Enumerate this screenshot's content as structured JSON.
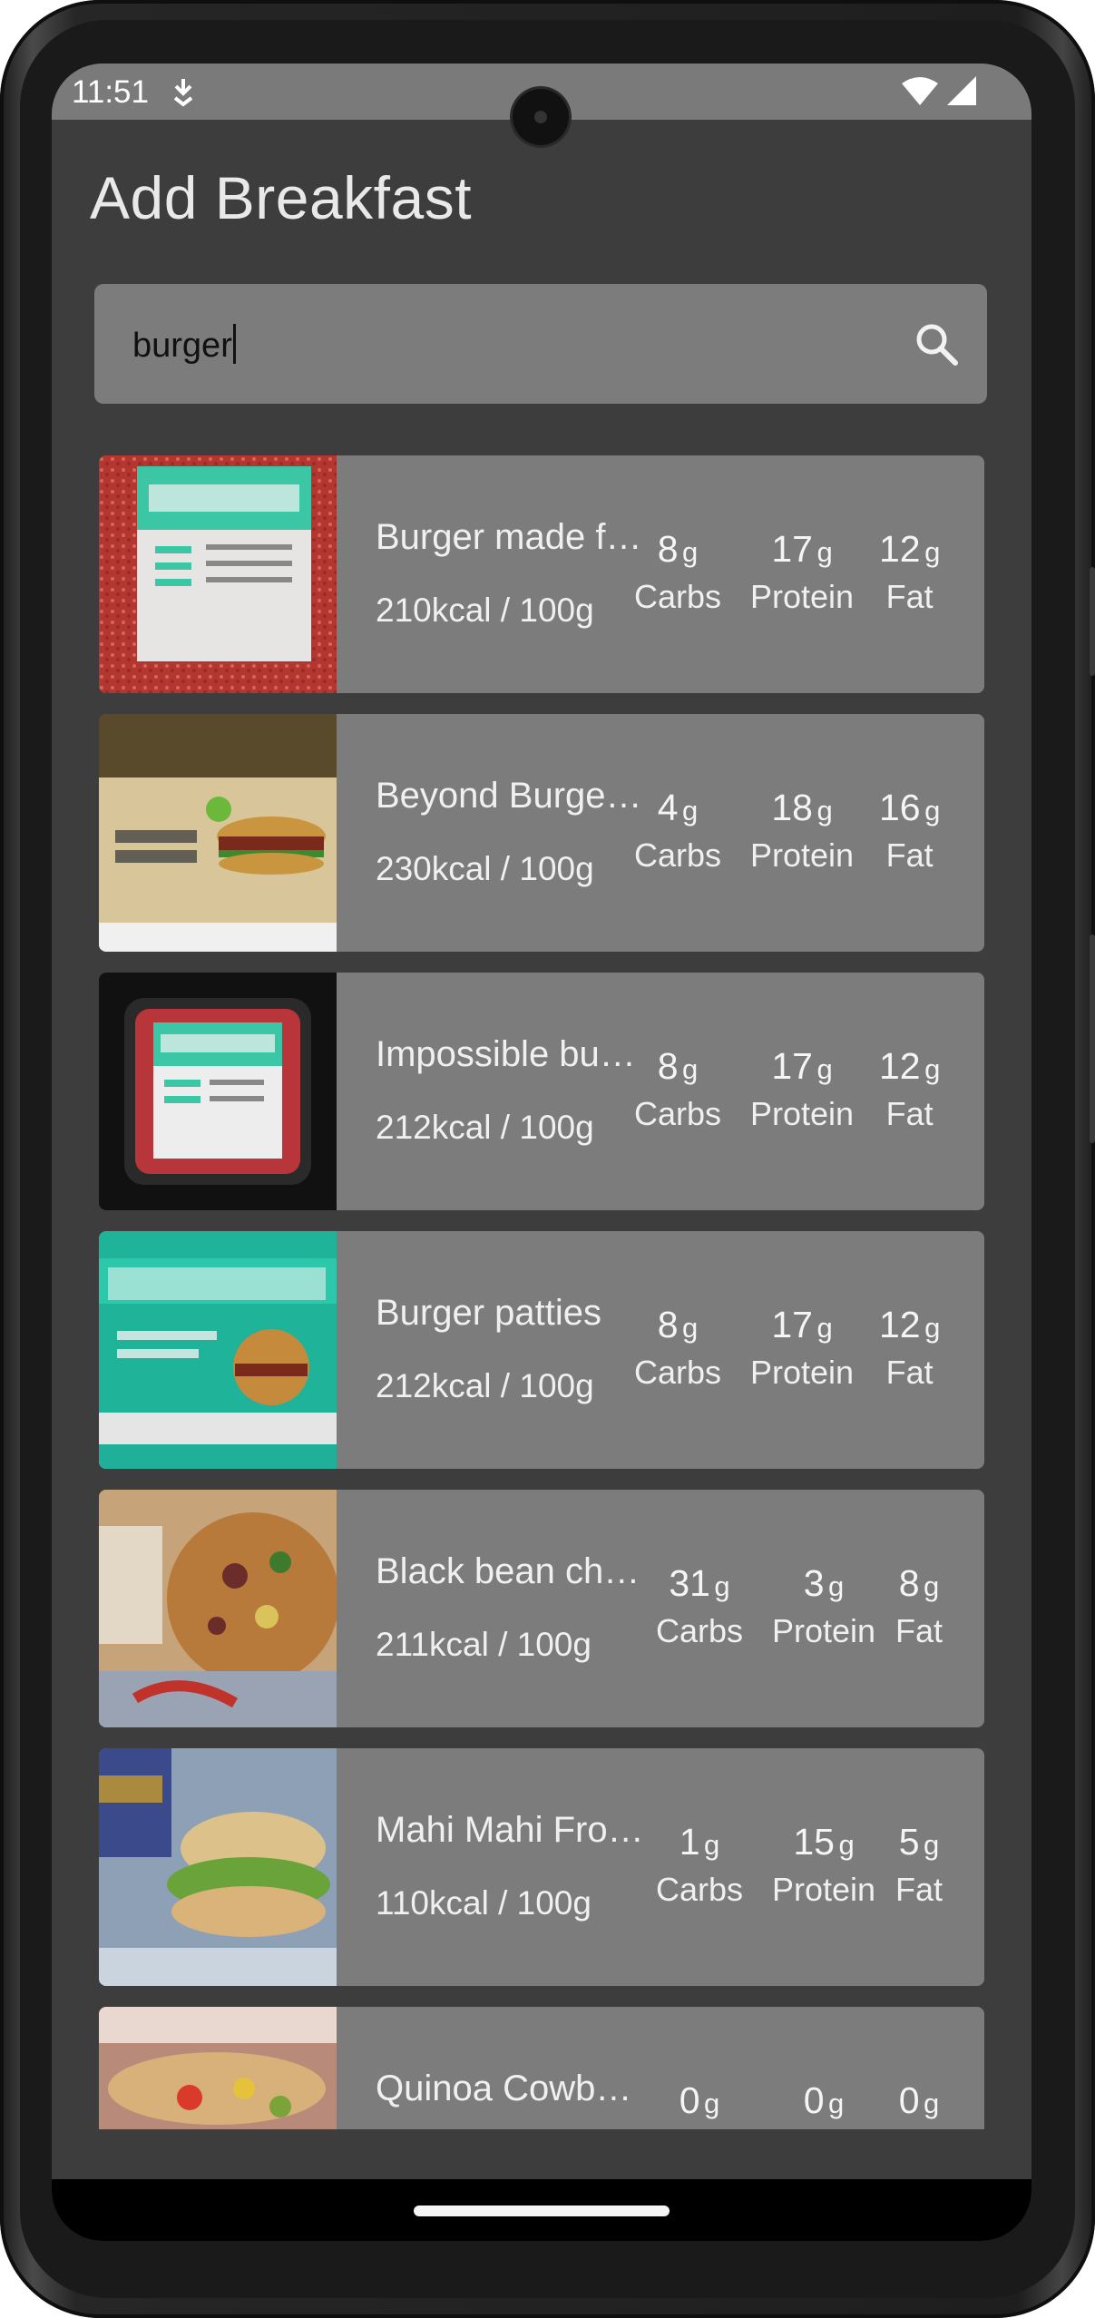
{
  "status_bar": {
    "time": "11:51"
  },
  "header": {
    "title": "Add Breakfast"
  },
  "search": {
    "value": "burger"
  },
  "items": [
    {
      "name": "Burger made f…",
      "kcal": "210kcal / 100g",
      "carbs": "8",
      "protein": "17",
      "fat": "12"
    },
    {
      "name": "Beyond Burge…",
      "kcal": "230kcal / 100g",
      "carbs": "4",
      "protein": "18",
      "fat": "16"
    },
    {
      "name": "Impossible bu…",
      "kcal": "212kcal / 100g",
      "carbs": "8",
      "protein": "17",
      "fat": "12"
    },
    {
      "name": "Burger patties",
      "kcal": "212kcal / 100g",
      "carbs": "8",
      "protein": "17",
      "fat": "12"
    },
    {
      "name": "Black bean chi…",
      "kcal": "211kcal / 100g",
      "carbs": "31",
      "protein": "3",
      "fat": "8"
    },
    {
      "name": "Mahi Mahi Froz…",
      "kcal": "110kcal / 100g",
      "carbs": "1",
      "protein": "15",
      "fat": "5"
    },
    {
      "name": "Quinoa Cowbo…",
      "kcal": "",
      "carbs": "0",
      "protein": "0",
      "fat": "0"
    }
  ],
  "labels": {
    "unit": "g",
    "carbs": "Carbs",
    "protein": "Protein",
    "fat": "Fat"
  },
  "icons": {
    "search": "search-icon",
    "wifi": "wifi-icon",
    "signal": "signal-icon",
    "notification": "download-notification-icon"
  }
}
